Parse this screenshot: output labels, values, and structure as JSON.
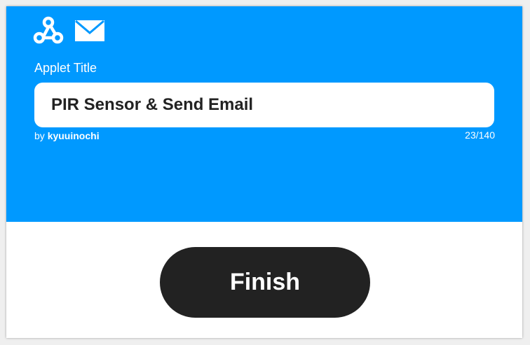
{
  "header": {
    "background_color": "#0099ff",
    "service_icons": [
      "webhook-icon",
      "mail-icon"
    ]
  },
  "applet": {
    "title_label": "Applet Title",
    "title_value": "PIR Sensor & Send Email",
    "by_prefix": "by",
    "author": "kyuuinochi",
    "char_count": "23/140"
  },
  "actions": {
    "finish_label": "Finish",
    "finish_color": "#222222"
  }
}
